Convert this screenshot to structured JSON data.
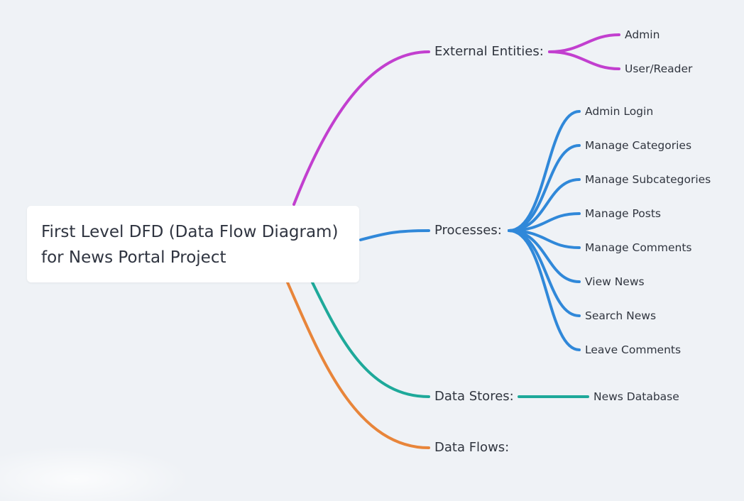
{
  "root": {
    "line1": "First Level DFD (Data Flow Diagram)",
    "line2": "for News Portal Project"
  },
  "branches": {
    "external": {
      "label": "External Entities:",
      "color": "#c23fcf",
      "items": [
        "Admin",
        "User/Reader"
      ]
    },
    "processes": {
      "label": "Processes:",
      "color": "#3088d9",
      "items": [
        "Admin Login",
        "Manage Categories",
        "Manage Subcategories",
        "Manage Posts",
        "Manage Comments",
        "View News",
        "Search News",
        "Leave Comments"
      ]
    },
    "stores": {
      "label": "Data Stores:",
      "color": "#1ea99a",
      "items": [
        "News Database"
      ]
    },
    "flows": {
      "label": "Data Flows:",
      "color": "#e8853a",
      "items": []
    }
  }
}
